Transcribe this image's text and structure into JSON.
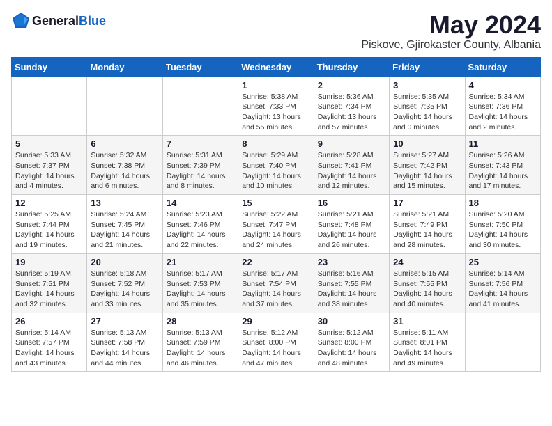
{
  "logo": {
    "text_general": "General",
    "text_blue": "Blue"
  },
  "header": {
    "month_year": "May 2024",
    "location": "Piskove, Gjirokaster County, Albania"
  },
  "days_of_week": [
    "Sunday",
    "Monday",
    "Tuesday",
    "Wednesday",
    "Thursday",
    "Friday",
    "Saturday"
  ],
  "weeks": [
    [
      {
        "day": "",
        "info": ""
      },
      {
        "day": "",
        "info": ""
      },
      {
        "day": "",
        "info": ""
      },
      {
        "day": "1",
        "info": "Sunrise: 5:38 AM\nSunset: 7:33 PM\nDaylight: 13 hours\nand 55 minutes."
      },
      {
        "day": "2",
        "info": "Sunrise: 5:36 AM\nSunset: 7:34 PM\nDaylight: 13 hours\nand 57 minutes."
      },
      {
        "day": "3",
        "info": "Sunrise: 5:35 AM\nSunset: 7:35 PM\nDaylight: 14 hours\nand 0 minutes."
      },
      {
        "day": "4",
        "info": "Sunrise: 5:34 AM\nSunset: 7:36 PM\nDaylight: 14 hours\nand 2 minutes."
      }
    ],
    [
      {
        "day": "5",
        "info": "Sunrise: 5:33 AM\nSunset: 7:37 PM\nDaylight: 14 hours\nand 4 minutes."
      },
      {
        "day": "6",
        "info": "Sunrise: 5:32 AM\nSunset: 7:38 PM\nDaylight: 14 hours\nand 6 minutes."
      },
      {
        "day": "7",
        "info": "Sunrise: 5:31 AM\nSunset: 7:39 PM\nDaylight: 14 hours\nand 8 minutes."
      },
      {
        "day": "8",
        "info": "Sunrise: 5:29 AM\nSunset: 7:40 PM\nDaylight: 14 hours\nand 10 minutes."
      },
      {
        "day": "9",
        "info": "Sunrise: 5:28 AM\nSunset: 7:41 PM\nDaylight: 14 hours\nand 12 minutes."
      },
      {
        "day": "10",
        "info": "Sunrise: 5:27 AM\nSunset: 7:42 PM\nDaylight: 14 hours\nand 15 minutes."
      },
      {
        "day": "11",
        "info": "Sunrise: 5:26 AM\nSunset: 7:43 PM\nDaylight: 14 hours\nand 17 minutes."
      }
    ],
    [
      {
        "day": "12",
        "info": "Sunrise: 5:25 AM\nSunset: 7:44 PM\nDaylight: 14 hours\nand 19 minutes."
      },
      {
        "day": "13",
        "info": "Sunrise: 5:24 AM\nSunset: 7:45 PM\nDaylight: 14 hours\nand 21 minutes."
      },
      {
        "day": "14",
        "info": "Sunrise: 5:23 AM\nSunset: 7:46 PM\nDaylight: 14 hours\nand 22 minutes."
      },
      {
        "day": "15",
        "info": "Sunrise: 5:22 AM\nSunset: 7:47 PM\nDaylight: 14 hours\nand 24 minutes."
      },
      {
        "day": "16",
        "info": "Sunrise: 5:21 AM\nSunset: 7:48 PM\nDaylight: 14 hours\nand 26 minutes."
      },
      {
        "day": "17",
        "info": "Sunrise: 5:21 AM\nSunset: 7:49 PM\nDaylight: 14 hours\nand 28 minutes."
      },
      {
        "day": "18",
        "info": "Sunrise: 5:20 AM\nSunset: 7:50 PM\nDaylight: 14 hours\nand 30 minutes."
      }
    ],
    [
      {
        "day": "19",
        "info": "Sunrise: 5:19 AM\nSunset: 7:51 PM\nDaylight: 14 hours\nand 32 minutes."
      },
      {
        "day": "20",
        "info": "Sunrise: 5:18 AM\nSunset: 7:52 PM\nDaylight: 14 hours\nand 33 minutes."
      },
      {
        "day": "21",
        "info": "Sunrise: 5:17 AM\nSunset: 7:53 PM\nDaylight: 14 hours\nand 35 minutes."
      },
      {
        "day": "22",
        "info": "Sunrise: 5:17 AM\nSunset: 7:54 PM\nDaylight: 14 hours\nand 37 minutes."
      },
      {
        "day": "23",
        "info": "Sunrise: 5:16 AM\nSunset: 7:55 PM\nDaylight: 14 hours\nand 38 minutes."
      },
      {
        "day": "24",
        "info": "Sunrise: 5:15 AM\nSunset: 7:55 PM\nDaylight: 14 hours\nand 40 minutes."
      },
      {
        "day": "25",
        "info": "Sunrise: 5:14 AM\nSunset: 7:56 PM\nDaylight: 14 hours\nand 41 minutes."
      }
    ],
    [
      {
        "day": "26",
        "info": "Sunrise: 5:14 AM\nSunset: 7:57 PM\nDaylight: 14 hours\nand 43 minutes."
      },
      {
        "day": "27",
        "info": "Sunrise: 5:13 AM\nSunset: 7:58 PM\nDaylight: 14 hours\nand 44 minutes."
      },
      {
        "day": "28",
        "info": "Sunrise: 5:13 AM\nSunset: 7:59 PM\nDaylight: 14 hours\nand 46 minutes."
      },
      {
        "day": "29",
        "info": "Sunrise: 5:12 AM\nSunset: 8:00 PM\nDaylight: 14 hours\nand 47 minutes."
      },
      {
        "day": "30",
        "info": "Sunrise: 5:12 AM\nSunset: 8:00 PM\nDaylight: 14 hours\nand 48 minutes."
      },
      {
        "day": "31",
        "info": "Sunrise: 5:11 AM\nSunset: 8:01 PM\nDaylight: 14 hours\nand 49 minutes."
      },
      {
        "day": "",
        "info": ""
      }
    ]
  ]
}
